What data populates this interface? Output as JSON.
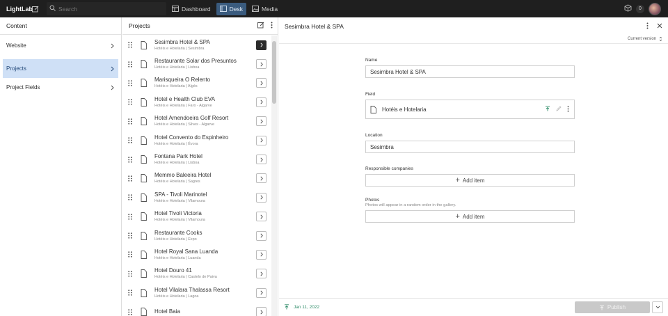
{
  "topbar": {
    "brand": "LightLab",
    "search_placeholder": "Search",
    "tabs": [
      {
        "label": "Dashboard",
        "active": false
      },
      {
        "label": "Desk",
        "active": true
      },
      {
        "label": "Media",
        "active": false
      }
    ],
    "notification_count": "0"
  },
  "content_pane": {
    "title": "Content",
    "items": [
      {
        "label": "Website",
        "active": false
      },
      {
        "label": "Projects",
        "active": true
      },
      {
        "label": "Project Fields",
        "active": false
      }
    ]
  },
  "projects_pane": {
    "title": "Projects",
    "items": [
      {
        "title": "Sesimbra Hotel & SPA",
        "subtitle": "Hotéis e Hotelaria | Sesimbra",
        "active": true
      },
      {
        "title": "Restaurante Solar dos Presuntos",
        "subtitle": "Hotéis e Hotelaria | Lisboa",
        "active": false
      },
      {
        "title": "Marisqueira O Relento",
        "subtitle": "Hotéis e Hotelaria | Algés",
        "active": false
      },
      {
        "title": "Hotel e Health Club EVA",
        "subtitle": "Hotéis e Hotelaria | Faro - Algarve",
        "active": false
      },
      {
        "title": "Hotel Amendoeira Golf Resort",
        "subtitle": "Hotéis e Hotelaria | Silves - Algarve",
        "active": false
      },
      {
        "title": "Hotel Convento do Espinheiro",
        "subtitle": "Hotéis e Hotelaria | Évora",
        "active": false
      },
      {
        "title": "Fontana Park Hotel",
        "subtitle": "Hotéis e Hotelaria | Lisboa",
        "active": false
      },
      {
        "title": "Memmo Baleeira Hotel",
        "subtitle": "Hotéis e Hotelaria | Sagres",
        "active": false
      },
      {
        "title": "SPA - Tivoli Marinotel",
        "subtitle": "Hotéis e Hotelaria | Vilamoura",
        "active": false
      },
      {
        "title": "Hotel Tivoli Victoria",
        "subtitle": "Hotéis e Hotelaria | Vilamoura",
        "active": false
      },
      {
        "title": "Restaurante Cooks",
        "subtitle": "Hotéis e Hotelaria | Expo",
        "active": false
      },
      {
        "title": "Hotel Royal Sana Luanda",
        "subtitle": "Hotéis e Hotelaria | Luanda",
        "active": false
      },
      {
        "title": "Hotel Douro 41",
        "subtitle": "Hotéis e Hotelaria | Castelo de Paiva",
        "active": false
      },
      {
        "title": "Hotel Vilalara Thalassa Resort",
        "subtitle": "Hotéis e Hotelaria | Lagoa",
        "active": false
      },
      {
        "title": "Hotel Baia",
        "subtitle": "",
        "active": false
      }
    ]
  },
  "document": {
    "title": "Sesimbra Hotel & SPA",
    "version_label": "Current version",
    "fields": {
      "name_label": "Name",
      "name_value": "Sesimbra Hotel & SPA",
      "field_label": "Field",
      "field_value": "Hotéis e Hotelaria",
      "location_label": "Location",
      "location_value": "Sesimbra",
      "companies_label": "Responsible companies",
      "add_item_label": "Add item",
      "photos_label": "Photos",
      "photos_description": "Photos will appear in a random order in the gallery.",
      "photos_add_label": "Add item"
    },
    "footer": {
      "date": "Jan 11, 2022",
      "publish_label": "Publish"
    }
  },
  "colors": {
    "topbar_bg": "#1f1f1f",
    "active_tab_bg": "#3a5b7e",
    "active_nav_bg": "#cfe0f6",
    "published_green": "#2d8c68",
    "publish_disabled": "#c9c9c9"
  }
}
